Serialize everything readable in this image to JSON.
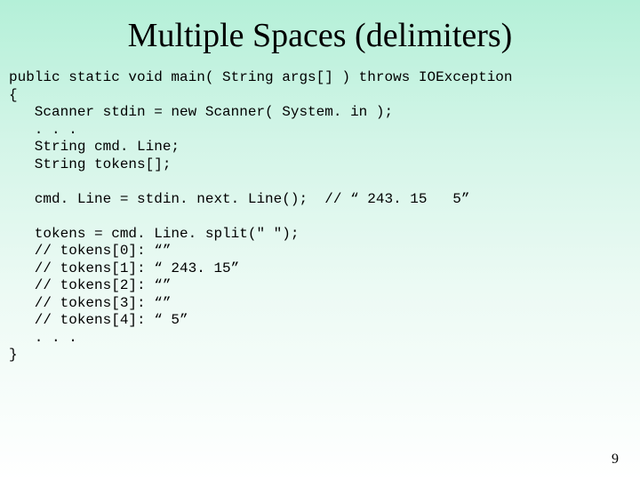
{
  "title": "Multiple Spaces (delimiters)",
  "code": {
    "l1": "public static void main( String args[] ) throws IOException",
    "l2": "{",
    "l3": "   Scanner stdin = new Scanner( System. in );",
    "l4": "   . . .",
    "l5": "   String cmd. Line;",
    "l6": "   String tokens[];",
    "l7": "",
    "l8": "   cmd. Line = stdin. next. Line();  // “ 243. 15   5”",
    "l9": "",
    "l10": "   tokens = cmd. Line. split(\" \");",
    "l11": "   // tokens[0]: “”",
    "l12": "   // tokens[1]: “ 243. 15”",
    "l13": "   // tokens[2]: “”",
    "l14": "   // tokens[3]: “”",
    "l15": "   // tokens[4]: “ 5”",
    "l16": "   . . .",
    "l17": "}"
  },
  "pagenum": "9"
}
